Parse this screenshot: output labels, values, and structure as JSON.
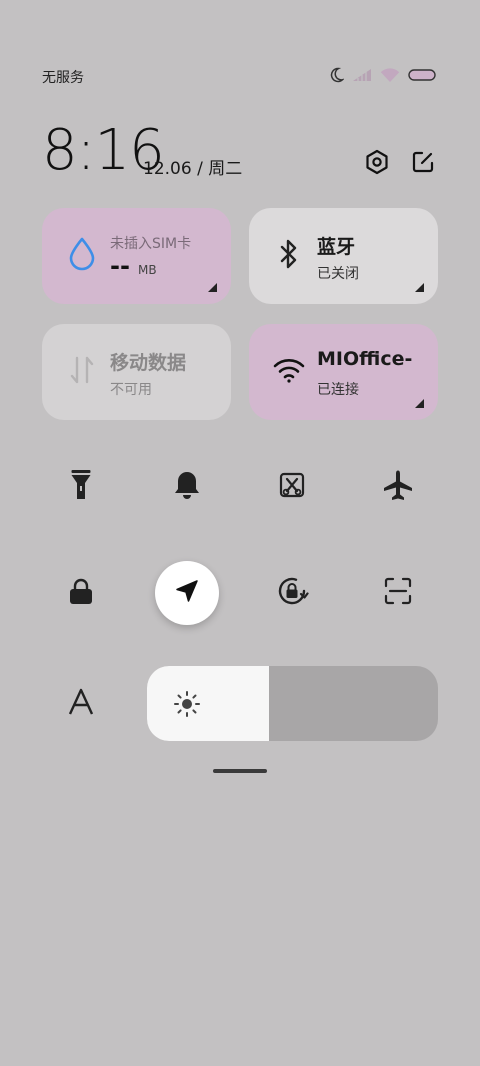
{
  "status_bar": {
    "carrier": "无服务",
    "icons": [
      "moon-icon",
      "signal-icon",
      "wifi-icon",
      "battery-icon"
    ]
  },
  "header": {
    "time": "8:16",
    "date": "12.06 / 周二",
    "icons": [
      "settings-icon",
      "edit-icon"
    ]
  },
  "tiles": {
    "data_usage": {
      "title": "未插入SIM卡",
      "value": "--",
      "unit": "MB",
      "state": "on"
    },
    "bluetooth": {
      "title": "蓝牙",
      "subtitle": "已关闭",
      "state": "off"
    },
    "mobile_data": {
      "title": "移动数据",
      "subtitle": "不可用",
      "state": "disabled"
    },
    "wifi": {
      "title": "MIOffice-",
      "subtitle": "已连接",
      "state": "on"
    }
  },
  "toggles": {
    "row1": [
      "flashlight-icon",
      "bell-icon",
      "screenshot-icon",
      "airplane-icon"
    ],
    "row2": [
      "lock-icon",
      "location-icon",
      "rotation-lock-icon",
      "scan-icon"
    ],
    "active": "location-icon"
  },
  "brightness": {
    "level": 0.42,
    "auto_label_icon": "auto-brightness-icon",
    "sun_icon": "sun-icon"
  },
  "colors": {
    "background": "#c3c1c2",
    "tile_active": "#d3b8cf",
    "tile_inactive": "#dcdadb",
    "accent_blue": "#3e8ee8"
  }
}
